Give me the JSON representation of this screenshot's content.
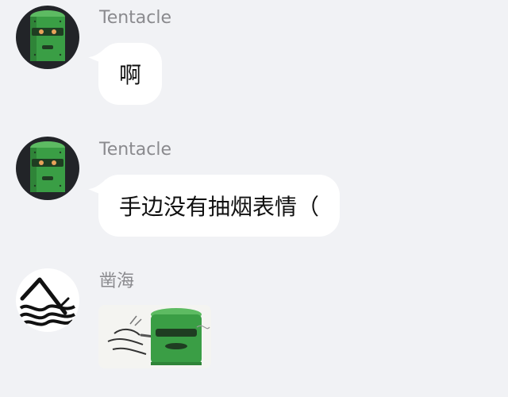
{
  "chat": {
    "messages": [
      {
        "sender": "Tentacle",
        "avatar_icon": "green-robot-avatar-icon",
        "type": "text",
        "text": "啊"
      },
      {
        "sender": "Tentacle",
        "avatar_icon": "green-robot-avatar-icon",
        "type": "text",
        "text": "手边没有抽烟表情（"
      },
      {
        "sender": "凿海",
        "avatar_icon": "pickaxe-waves-avatar-icon",
        "type": "sticker",
        "sticker_icon": "smoking-robot-sticker-icon"
      }
    ]
  },
  "colors": {
    "background": "#f1f2f5",
    "bubble": "#ffffff",
    "sender_text": "#8a8a8e",
    "message_text": "#111111",
    "robot_green": "#3a9e45"
  }
}
